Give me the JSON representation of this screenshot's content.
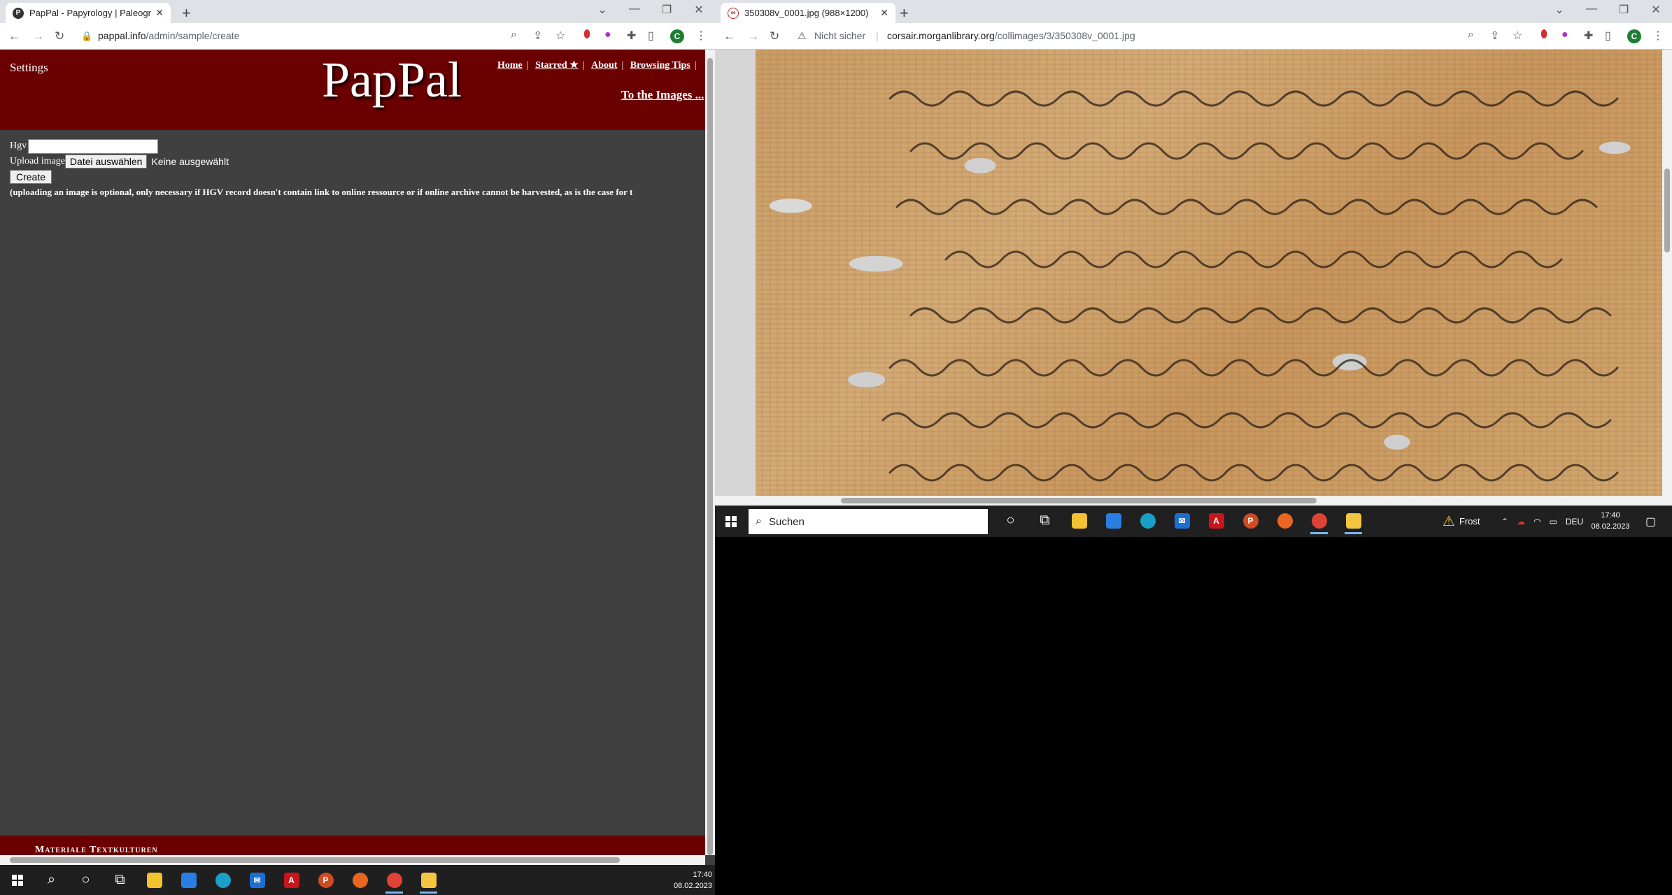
{
  "left_window": {
    "tab_title": "PapPal - Papyrology | Paleograph...",
    "url_host": "pappal.info",
    "url_path": "/admin/sample/create",
    "avatar_letter": "C",
    "header": {
      "settings_label": "Settings",
      "logo_text": "PapPal",
      "nav": [
        "Home",
        "Starred ★",
        "About",
        "Browsing Tips"
      ],
      "to_images_label": "To the Images ..."
    },
    "form": {
      "hgv_label": "Hgv",
      "hgv_value": "",
      "upload_label": "Upload image",
      "file_button_label": "Datei auswählen",
      "file_status": "Keine ausgewählt",
      "create_button_label": "Create",
      "note": "(uploading an image is optional, only necessary if HGV record doesn't contain link to online ressource or if online archive cannot be harvested, as is the case for t"
    },
    "footer_text": "Materiale Textkulturen",
    "taskbar": {
      "time": "17:40",
      "date": "08.02.2023"
    }
  },
  "right_window": {
    "tab_title": "350308v_0001.jpg (988×1200)",
    "security_label": "Nicht sicher",
    "url_host": "corsair.morganlibrary.org",
    "url_path": "/collimages/3/350308v_0001.jpg",
    "avatar_letter": "C",
    "taskbar": {
      "search_placeholder": "Suchen",
      "weather": "Frost",
      "language": "DEU",
      "time": "17:40",
      "date": "08.02.2023"
    }
  },
  "colors": {
    "pappal_red": "#6b0000",
    "page_bg": "#404040",
    "taskbar": "#1f1f1f"
  },
  "icons": [
    "search-icon",
    "share-icon",
    "star-icon",
    "extension-icon",
    "sidepanel-icon",
    "windows-start-icon",
    "task-view-icon",
    "file-explorer-icon",
    "edge-icon",
    "chrome-icon",
    "firefox-icon",
    "mail-icon",
    "acrobat-icon",
    "powerpoint-icon"
  ]
}
